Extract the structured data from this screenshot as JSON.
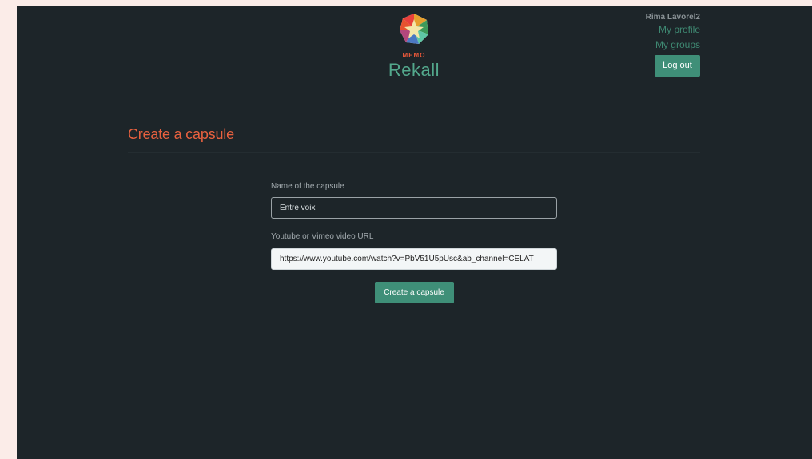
{
  "brand": {
    "tagline": "MEMO",
    "name": "Rekall",
    "colors": {
      "memo": "#e8583a",
      "rekall": "#53a88c"
    }
  },
  "user_menu": {
    "username": "Rima Lavorel2",
    "profile_link": "My profile",
    "groups_link": "My groups",
    "logout_label": "Log out"
  },
  "page": {
    "title": "Create a capsule"
  },
  "form": {
    "name_label": "Name of the capsule",
    "name_value": "Entre voix",
    "url_label": "Youtube or Vimeo video URL",
    "url_value": "https://www.youtube.com/watch?v=PbV51U5pUsc&ab_channel=CELAT",
    "submit_label": "Create a capsule"
  },
  "theme": {
    "background": "#1d2529",
    "accent": "#3f8f78",
    "title": "#e8613f"
  }
}
